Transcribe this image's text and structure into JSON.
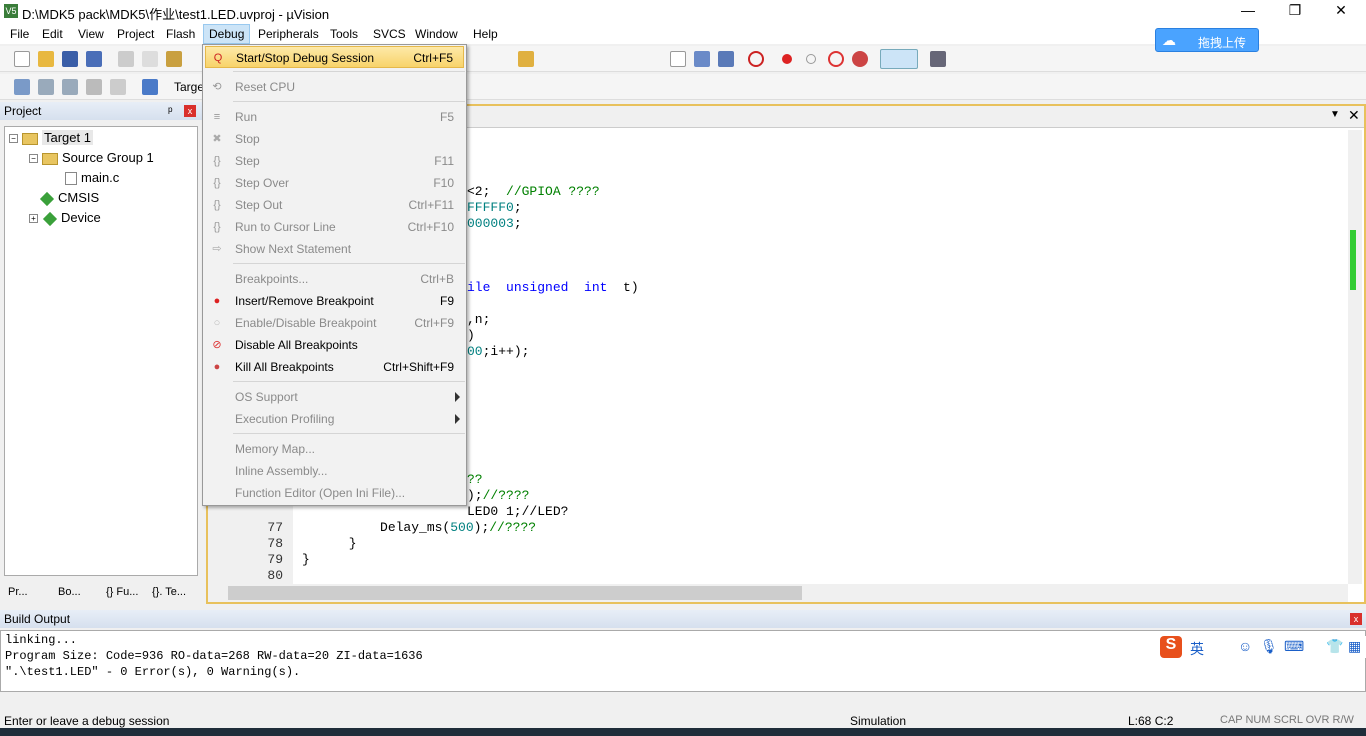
{
  "window": {
    "title": "D:\\MDK5 pack\\MDK5\\作业\\test1.LED.uvproj - µVision",
    "logo": "V5",
    "minimize": "—",
    "maximize": "❐",
    "close": "✕"
  },
  "menubar": [
    "File",
    "Edit",
    "View",
    "Project",
    "Flash",
    "Debug",
    "Peripherals",
    "Tools",
    "SVCS",
    "Window",
    "Help"
  ],
  "toolbar2": {
    "target_label": "Targe"
  },
  "upload_button": "拖拽上传",
  "project_panel": {
    "title": "Project",
    "tree": [
      {
        "label": "Target 1",
        "expander": "−"
      },
      {
        "label": "Source Group 1",
        "expander": "−"
      },
      {
        "label": "main.c"
      },
      {
        "label": "CMSIS"
      },
      {
        "label": "Device",
        "expander": "+"
      }
    ],
    "tabs": [
      "Pr...",
      "Bo...",
      "{} Fu...",
      "{}. Te..."
    ]
  },
  "debug_menu": [
    {
      "label": "Start/Stop Debug Session",
      "shortcut": "Ctrl+F5",
      "enabled": true,
      "highlighted": true,
      "icon": "debug-session-icon"
    },
    {
      "separator": true
    },
    {
      "label": "Reset CPU",
      "shortcut": "",
      "enabled": false,
      "icon": "reset-icon"
    },
    {
      "separator": true
    },
    {
      "label": "Run",
      "shortcut": "F5",
      "enabled": false,
      "icon": "run-icon"
    },
    {
      "label": "Stop",
      "shortcut": "",
      "enabled": false,
      "icon": "stop-icon"
    },
    {
      "label": "Step",
      "shortcut": "F11",
      "enabled": false,
      "icon": "step-icon"
    },
    {
      "label": "Step Over",
      "shortcut": "F10",
      "enabled": false,
      "icon": "step-over-icon"
    },
    {
      "label": "Step Out",
      "shortcut": "Ctrl+F11",
      "enabled": false,
      "icon": "step-out-icon"
    },
    {
      "label": "Run to Cursor Line",
      "shortcut": "Ctrl+F10",
      "enabled": false,
      "icon": "run-to-cursor-icon"
    },
    {
      "label": "Show Next Statement",
      "shortcut": "",
      "enabled": false,
      "icon": "arrow-right-icon"
    },
    {
      "separator": true
    },
    {
      "label": "Breakpoints...",
      "shortcut": "Ctrl+B",
      "enabled": false
    },
    {
      "label": "Insert/Remove Breakpoint",
      "shortcut": "F9",
      "enabled": true,
      "icon": "breakpoint-icon"
    },
    {
      "label": "Enable/Disable Breakpoint",
      "shortcut": "Ctrl+F9",
      "enabled": false,
      "icon": "breakpoint-outline-icon"
    },
    {
      "label": "Disable All Breakpoints",
      "shortcut": "",
      "enabled": true,
      "icon": "disable-breakpoints-icon"
    },
    {
      "label": "Kill All Breakpoints",
      "shortcut": "Ctrl+Shift+F9",
      "enabled": true,
      "icon": "kill-breakpoints-icon"
    },
    {
      "separator": true
    },
    {
      "label": "OS Support",
      "shortcut": "",
      "enabled": false,
      "submenu": true
    },
    {
      "label": "Execution Profiling",
      "shortcut": "",
      "enabled": false,
      "submenu": true
    },
    {
      "separator": true
    },
    {
      "label": "Memory Map...",
      "shortcut": "",
      "enabled": false
    },
    {
      "label": "Inline Assembly...",
      "shortcut": "",
      "enabled": false
    },
    {
      "label": "Function Editor (Open Ini File)...",
      "shortcut": "",
      "enabled": false
    }
  ],
  "editor": {
    "fragments": [
      {
        "line": 56,
        "text": "<2;  ",
        "comment": "//GPIOA ????"
      },
      {
        "line": 57,
        "num": "FFFFF0",
        ";": ";"
      },
      {
        "line": 58,
        "num": "000003",
        ";": ";"
      },
      {
        "line": 62,
        "kwpre": "ile  ",
        "kw": "unsigned  int",
        "post": "  t)"
      },
      {
        "line": 64,
        "text": ",n;"
      },
      {
        "line": 65,
        "text": ")"
      },
      {
        "line": 66,
        "num": "00",
        "post": ";i++);"
      },
      {
        "line": 74,
        "comment": "??"
      },
      {
        "line": 75,
        "text": ");",
        "comment": "//????"
      },
      {
        "line": 76,
        "text": "LED0 1;//LED?"
      }
    ],
    "lines": [
      {
        "n": "77",
        "pre": "          Delay_ms(",
        "num": "500",
        "post": ");",
        "comment": "//????"
      },
      {
        "n": "78",
        "pre": "      }"
      },
      {
        "n": "79",
        "pre": "}"
      },
      {
        "n": "80",
        "pre": ""
      }
    ]
  },
  "build_output": {
    "title": "Build Output",
    "lines": [
      "linking...",
      "Program Size: Code=936 RO-data=268 RW-data=20 ZI-data=1636",
      "\".\\test1.LED\" - 0 Error(s), 0 Warning(s)."
    ]
  },
  "ime": {
    "logo": "S",
    "mode": "英"
  },
  "status": {
    "message": "Enter or leave a debug session",
    "mode": "Simulation",
    "position": "L:68 C:2",
    "flags": [
      "CAP",
      "NUM",
      "SCRL",
      "OVR",
      "R/W"
    ]
  }
}
